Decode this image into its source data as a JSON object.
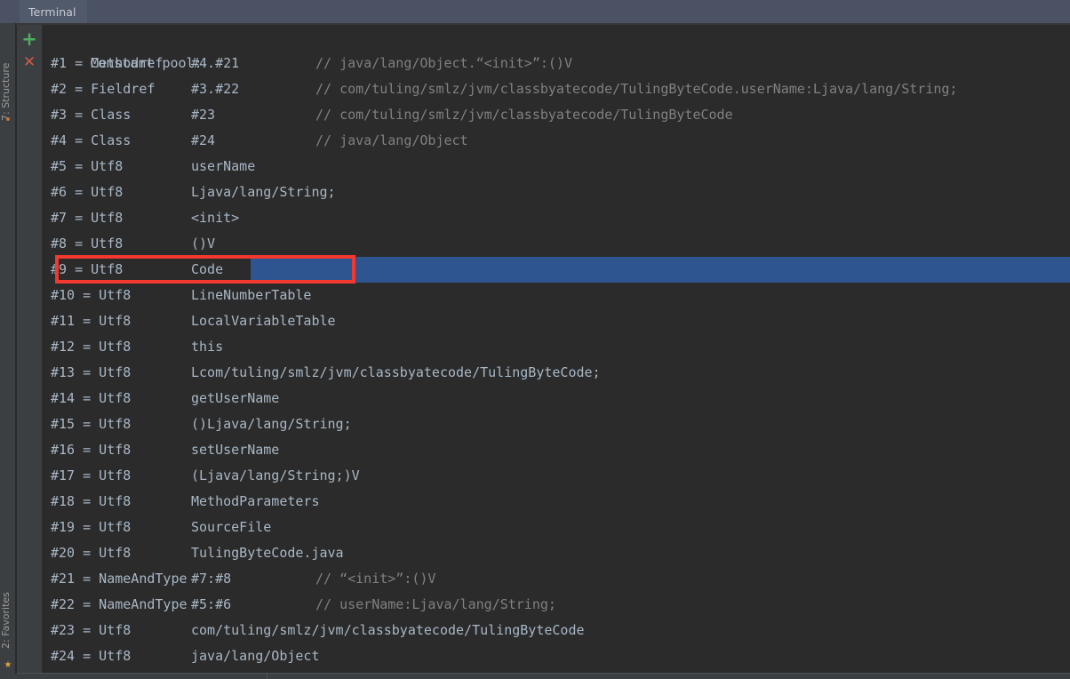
{
  "window": {
    "tab_label": "Terminal"
  },
  "sidebar": {
    "top_label": "7: Structure",
    "bottom_label": "2: Favorites",
    "structure_icon": "•",
    "star_icon": "★"
  },
  "toolbar": {
    "add_label": "+",
    "close_label": "✕"
  },
  "console": {
    "header": "Constant pool:",
    "rows": [
      {
        "index": "#1 = Methodref",
        "value": "#4.#21",
        "comment": "// java/lang/Object.“<init>”:()V"
      },
      {
        "index": "#2 = Fieldref",
        "value": "#3.#22",
        "comment": "// com/tuling/smlz/jvm/classbyatecode/TulingByteCode.userName:Ljava/lang/String;"
      },
      {
        "index": "#3 = Class",
        "value": "#23",
        "comment": "// com/tuling/smlz/jvm/classbyatecode/TulingByteCode"
      },
      {
        "index": "#4 = Class",
        "value": "#24",
        "comment": "// java/lang/Object"
      },
      {
        "index": "#5 = Utf8",
        "value": "userName",
        "comment": ""
      },
      {
        "index": "#6 = Utf8",
        "value": "Ljava/lang/String;",
        "comment": ""
      },
      {
        "index": "#7 = Utf8",
        "value": "<init>",
        "comment": ""
      },
      {
        "index": "#8 = Utf8",
        "value": "()V",
        "comment": ""
      },
      {
        "index": "#9 = Utf8",
        "value": "Code",
        "comment": "",
        "selected": true
      },
      {
        "index": "#10 = Utf8",
        "value": "LineNumberTable",
        "comment": ""
      },
      {
        "index": "#11 = Utf8",
        "value": "LocalVariableTable",
        "comment": ""
      },
      {
        "index": "#12 = Utf8",
        "value": "this",
        "comment": ""
      },
      {
        "index": "#13 = Utf8",
        "value": "Lcom/tuling/smlz/jvm/classbyatecode/TulingByteCode;",
        "comment": ""
      },
      {
        "index": "#14 = Utf8",
        "value": "getUserName",
        "comment": ""
      },
      {
        "index": "#15 = Utf8",
        "value": "()Ljava/lang/String;",
        "comment": ""
      },
      {
        "index": "#16 = Utf8",
        "value": "setUserName",
        "comment": ""
      },
      {
        "index": "#17 = Utf8",
        "value": "(Ljava/lang/String;)V",
        "comment": ""
      },
      {
        "index": "#18 = Utf8",
        "value": "MethodParameters",
        "comment": ""
      },
      {
        "index": "#19 = Utf8",
        "value": "SourceFile",
        "comment": ""
      },
      {
        "index": "#20 = Utf8",
        "value": "TulingByteCode.java",
        "comment": ""
      },
      {
        "index": "#21 = NameAndType",
        "value": "#7:#8",
        "comment": "// “<init>”:()V"
      },
      {
        "index": "#22 = NameAndType",
        "value": "#5:#6",
        "comment": "// userName:Ljava/lang/String;"
      },
      {
        "index": "#23 = Utf8",
        "value": "com/tuling/smlz/jvm/classbyatecode/TulingByteCode",
        "comment": ""
      },
      {
        "index": "#24 = Utf8",
        "value": "java/lang/Object",
        "comment": ""
      }
    ]
  },
  "annotation": {
    "highlight_color": "#f2382f",
    "selection_color": "#2f5591"
  },
  "colors": {
    "background": "#2b2b2b",
    "tabbar": "#4a5263",
    "tab_active": "#515a6b",
    "gutter": "#3c3f41",
    "text": "#a9b7c6",
    "comment": "#808080",
    "add_icon": "#4fae5e",
    "close_icon": "#cf5a47"
  }
}
